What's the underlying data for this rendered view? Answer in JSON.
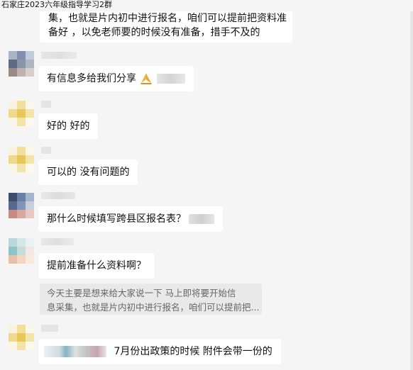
{
  "window": {
    "title": "石家庄2023六年级指导学习2群"
  },
  "messages": [
    {
      "text_line1": "集，也就是片内初中进行报名，咱们可以提前把资料准",
      "text_line2": "备好 ，以免老师要的时候没有准备，措手不及的"
    },
    {
      "text": "有信息多给我们分享"
    },
    {
      "text": "好的  好的"
    },
    {
      "text": "可以的  没有问题的"
    },
    {
      "text": "那什么时候填写跨县区报名表？"
    },
    {
      "text": "提前准备什么资料啊？"
    },
    {
      "quote_line1": "今天主要是想来给大家说一下 马上即将要开始信",
      "quote_line2": "息采集，也就是片内初中进行报名，咱们可以提前把..."
    },
    {
      "text": "7月份出政策的时候  附件会带一份的"
    }
  ],
  "icons": {
    "emoji_praying": "praying-hands-icon"
  },
  "colors": {
    "background": "#f5f5f5",
    "bubble": "#ffffff",
    "quote_bg": "#e9e9e9"
  }
}
